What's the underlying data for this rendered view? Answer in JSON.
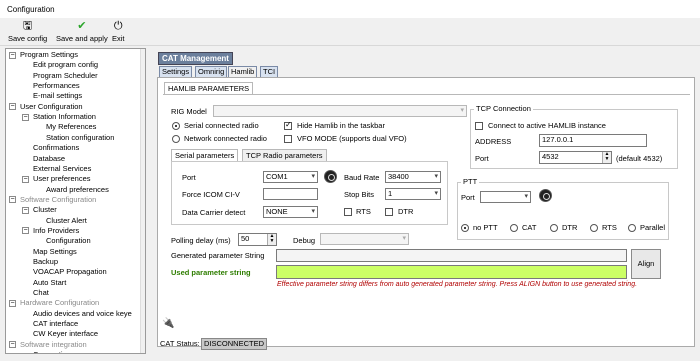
{
  "window": {
    "title": "Configuration"
  },
  "toolbar": {
    "save_config": "Save config",
    "save_apply": "Save and apply",
    "exit": "Exit"
  },
  "tree": {
    "items": [
      {
        "label": "Program Settings",
        "gray": false,
        "box": "-"
      },
      {
        "label": "Edit program config",
        "gray": false,
        "box": ""
      },
      {
        "label": "Program Scheduler",
        "gray": false,
        "box": ""
      },
      {
        "label": "Performances",
        "gray": false,
        "box": ""
      },
      {
        "label": "E-mail settings",
        "gray": false,
        "box": ""
      },
      {
        "label": "User Configuration",
        "gray": false,
        "box": "-"
      },
      {
        "label": "Station Information",
        "gray": false,
        "box": "-"
      },
      {
        "label": "My References",
        "gray": false,
        "box": ""
      },
      {
        "label": "Station configuration",
        "gray": false,
        "box": ""
      },
      {
        "label": "Confirmations",
        "gray": false,
        "box": ""
      },
      {
        "label": "Database",
        "gray": false,
        "box": ""
      },
      {
        "label": "External Services",
        "gray": false,
        "box": ""
      },
      {
        "label": "User preferences",
        "gray": false,
        "box": "-"
      },
      {
        "label": "Award preferences",
        "gray": false,
        "box": ""
      },
      {
        "label": "Software Configuration",
        "gray": true,
        "box": "-"
      },
      {
        "label": "Cluster",
        "gray": false,
        "box": "-"
      },
      {
        "label": "Cluster Alert",
        "gray": false,
        "box": ""
      },
      {
        "label": "Info Providers",
        "gray": false,
        "box": "-"
      },
      {
        "label": "Configuration",
        "gray": false,
        "box": ""
      },
      {
        "label": "Map Settings",
        "gray": false,
        "box": ""
      },
      {
        "label": "Backup",
        "gray": false,
        "box": ""
      },
      {
        "label": "VOACAP Propagation",
        "gray": false,
        "box": ""
      },
      {
        "label": "Auto Start",
        "gray": false,
        "box": ""
      },
      {
        "label": "Chat",
        "gray": false,
        "box": ""
      },
      {
        "label": "Hardware Configuration",
        "gray": true,
        "box": "-"
      },
      {
        "label": "Audio devices and voice keye",
        "gray": false,
        "box": ""
      },
      {
        "label": "CAT interface",
        "gray": false,
        "box": ""
      },
      {
        "label": "CW Keyer interface",
        "gray": false,
        "box": ""
      },
      {
        "label": "Software integration",
        "gray": true,
        "box": "-"
      },
      {
        "label": "Connections",
        "gray": false,
        "box": ""
      }
    ]
  },
  "cat": {
    "header": "CAT Management",
    "tabs": [
      "Settings",
      "Omnirig",
      "Hamlib",
      "TCI"
    ],
    "subtab": "HAMLIB PARAMETERS",
    "rig_model_label": "RIG Model",
    "rig_model_value": "",
    "serial_radio": "Serial connected radio",
    "network_radio": "Network connected radio",
    "hide_hamlib": "Hide Hamlib in the taskbar",
    "vfo_mode": "VFO MODE (supports dual VFO)",
    "inner_tabs": [
      "Serial parameters",
      "TCP Radio parameters"
    ],
    "port_label": "Port",
    "port_value": "COM1",
    "baud_label": "Baud Rate",
    "baud_value": "38400",
    "icom_label": "Force ICOM CI-V",
    "icom_value": "",
    "stop_label": "Stop Bits",
    "stop_value": "1",
    "dcd_label": "Data Carrier detect",
    "dcd_value": "NONE",
    "rts": "RTS",
    "dtr": "DTR",
    "tcp_title": "TCP Connection",
    "tcp_connect": "Connect to active HAMLIB instance",
    "address_label": "ADDRESS",
    "address_value": "127.0.0.1",
    "tcp_port_label": "Port",
    "tcp_port_value": "4532",
    "tcp_default": "(default 4532)",
    "ptt_title": "PTT",
    "ptt_port_label": "Port",
    "ptt_port_value": "",
    "ptt_options": [
      "no PTT",
      "CAT",
      "DTR",
      "RTS",
      "Parallel"
    ],
    "polling_label": "Polling delay (ms)",
    "polling_value": "50",
    "debug_label": "Debug",
    "debug_value": "",
    "generated_label": "Generated parameter String",
    "generated_value": "",
    "used_label": "Used parameter string",
    "used_value": "",
    "align_button": "Align",
    "warning": "Effective parameter string differs from auto generated parameter string. Press ALIGN button to use generated string.",
    "status_label": "CAT Status:",
    "status_value": "DISCONNECTED"
  },
  "colors": {
    "accent": "#6b7f9c",
    "used_green": "#ccff66",
    "used_label": "#2e7d00",
    "warning": "#b00000"
  }
}
